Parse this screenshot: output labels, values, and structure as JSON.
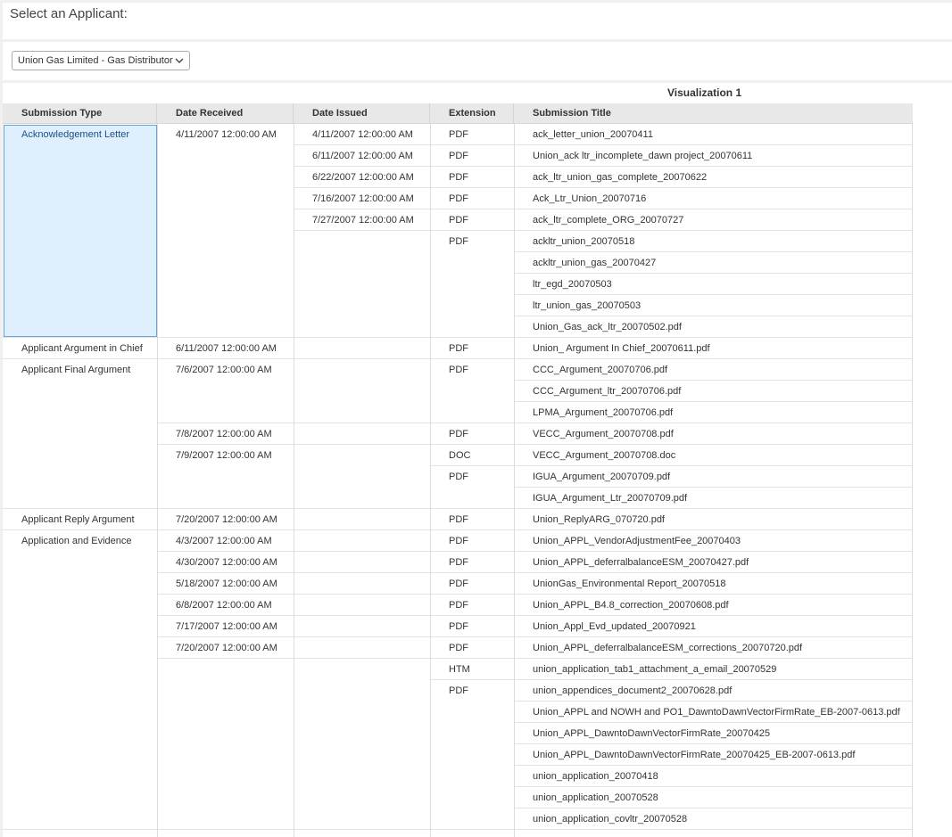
{
  "header": {
    "title": "Select an Applicant:"
  },
  "selector": {
    "value": "Union Gas Limited - Gas Distributor",
    "icon": "chevron-down-icon"
  },
  "viz": {
    "title": "Visualization 1"
  },
  "table": {
    "columns": [
      "Submission Type",
      "Date Received",
      "Date Issued",
      "Extension",
      "Submission Title"
    ],
    "selected_type": "Acknowledgement Letter",
    "groups": [
      {
        "type": "Acknowledgement Letter",
        "rows": 10,
        "received": [
          {
            "date": "4/11/2007 12:00:00 AM",
            "rows": 10,
            "issued": [
              {
                "date": "4/11/2007 12:00:00 AM",
                "exts": [
                  {
                    "ext": "PDF",
                    "titles": [
                      "ack_letter_union_20070411"
                    ]
                  }
                ]
              },
              {
                "date": "6/11/2007 12:00:00 AM",
                "exts": [
                  {
                    "ext": "PDF",
                    "titles": [
                      "Union_ack ltr_incomplete_dawn project_20070611"
                    ]
                  }
                ]
              },
              {
                "date": "6/22/2007 12:00:00 AM",
                "exts": [
                  {
                    "ext": "PDF",
                    "titles": [
                      "ack_ltr_union_gas_complete_20070622"
                    ]
                  }
                ]
              },
              {
                "date": "7/16/2007 12:00:00 AM",
                "exts": [
                  {
                    "ext": "PDF",
                    "titles": [
                      "Ack_Ltr_Union_20070716"
                    ]
                  }
                ]
              },
              {
                "date": "7/27/2007 12:00:00 AM",
                "exts": [
                  {
                    "ext": "PDF",
                    "titles": [
                      "ack_ltr_complete_ORG_20070727"
                    ]
                  }
                ]
              },
              {
                "date": "",
                "exts": [
                  {
                    "ext": "PDF",
                    "titles": [
                      "ackltr_union_20070518",
                      "ackltr_union_gas_20070427",
                      "ltr_egd_20070503",
                      "ltr_union_gas_20070503",
                      "Union_Gas_ack_ltr_20070502.pdf"
                    ]
                  }
                ]
              }
            ]
          }
        ]
      },
      {
        "type": "Applicant Argument in Chief",
        "rows": 1,
        "received": [
          {
            "date": "6/11/2007 12:00:00 AM",
            "rows": 1,
            "issued": [
              {
                "date": "",
                "exts": [
                  {
                    "ext": "PDF",
                    "titles": [
                      "Union_ Argument In Chief_20070611.pdf"
                    ]
                  }
                ]
              }
            ]
          }
        ]
      },
      {
        "type": "Applicant Final Argument",
        "rows": 7,
        "received": [
          {
            "date": "7/6/2007 12:00:00 AM",
            "rows": 3,
            "issued": [
              {
                "date": "",
                "exts": [
                  {
                    "ext": "PDF",
                    "titles": [
                      "CCC_Argument_20070706.pdf",
                      "CCC_Argument_ltr_20070706.pdf",
                      "LPMA_Argument_20070706.pdf"
                    ]
                  }
                ]
              }
            ]
          },
          {
            "date": "7/8/2007 12:00:00 AM",
            "rows": 1,
            "issued": [
              {
                "date": "",
                "exts": [
                  {
                    "ext": "PDF",
                    "titles": [
                      "VECC_Argument_20070708.pdf"
                    ]
                  }
                ]
              }
            ]
          },
          {
            "date": "7/9/2007 12:00:00 AM",
            "rows": 3,
            "issued": [
              {
                "date": "",
                "exts": [
                  {
                    "ext": "DOC",
                    "titles": [
                      "VECC_Argument_20070708.doc"
                    ]
                  },
                  {
                    "ext": "PDF",
                    "titles": [
                      "IGUA_Argument_20070709.pdf",
                      "IGUA_Argument_Ltr_20070709.pdf"
                    ]
                  }
                ]
              }
            ]
          }
        ]
      },
      {
        "type": "Applicant Reply Argument",
        "rows": 1,
        "received": [
          {
            "date": "7/20/2007 12:00:00 AM",
            "rows": 1,
            "issued": [
              {
                "date": "",
                "exts": [
                  {
                    "ext": "PDF",
                    "titles": [
                      "Union_ReplyARG_070720.pdf"
                    ]
                  }
                ]
              }
            ]
          }
        ]
      },
      {
        "type": "Application and Evidence",
        "rows": 15,
        "received": [
          {
            "date": "4/3/2007 12:00:00 AM",
            "rows": 1,
            "issued": [
              {
                "date": "",
                "exts": [
                  {
                    "ext": "PDF",
                    "titles": [
                      "Union_APPL_VendorAdjustmentFee_20070403"
                    ]
                  }
                ]
              }
            ]
          },
          {
            "date": "4/30/2007 12:00:00 AM",
            "rows": 1,
            "issued": [
              {
                "date": "",
                "exts": [
                  {
                    "ext": "PDF",
                    "titles": [
                      "Union_APPL_deferralbalanceESM_20070427.pdf"
                    ]
                  }
                ]
              }
            ]
          },
          {
            "date": "5/18/2007 12:00:00 AM",
            "rows": 1,
            "issued": [
              {
                "date": "",
                "exts": [
                  {
                    "ext": "PDF",
                    "titles": [
                      "UnionGas_Environmental Report_20070518"
                    ]
                  }
                ]
              }
            ]
          },
          {
            "date": "6/8/2007 12:00:00 AM",
            "rows": 1,
            "issued": [
              {
                "date": "",
                "exts": [
                  {
                    "ext": "PDF",
                    "titles": [
                      "Union_APPL_B4.8_correction_20070608.pdf"
                    ]
                  }
                ]
              }
            ]
          },
          {
            "date": "7/17/2007 12:00:00 AM",
            "rows": 1,
            "issued": [
              {
                "date": "",
                "exts": [
                  {
                    "ext": "PDF",
                    "titles": [
                      "Union_Appl_Evd_updated_20070921"
                    ]
                  }
                ]
              }
            ]
          },
          {
            "date": "7/20/2007 12:00:00 AM",
            "rows": 1,
            "issued": [
              {
                "date": "",
                "exts": [
                  {
                    "ext": "PDF",
                    "titles": [
                      "Union_APPL_deferralbalanceESM_corrections_20070720.pdf"
                    ]
                  }
                ]
              }
            ]
          },
          {
            "date": "",
            "rows": 9,
            "issued": [
              {
                "date": "",
                "exts": [
                  {
                    "ext": "HTM",
                    "titles": [
                      "union_application_tab1_attachment_a_email_20070529"
                    ]
                  },
                  {
                    "ext": "PDF",
                    "titles": [
                      "union_appendices_document2_20070628.pdf",
                      "Union_APPL and NOWH and PO1_DawntoDawnVectorFirmRate_EB-2007-0613.pdf",
                      "Union_APPL_DawntoDawnVectorFirmRate_20070425",
                      "Union_APPL_DawntoDawnVectorFirmRate_20070425_EB-2007-0613.pdf",
                      "union_application_20070418",
                      "union_application_20070528",
                      "union_application_covltr_20070528"
                    ]
                  }
                ]
              }
            ]
          }
        ]
      }
    ]
  }
}
